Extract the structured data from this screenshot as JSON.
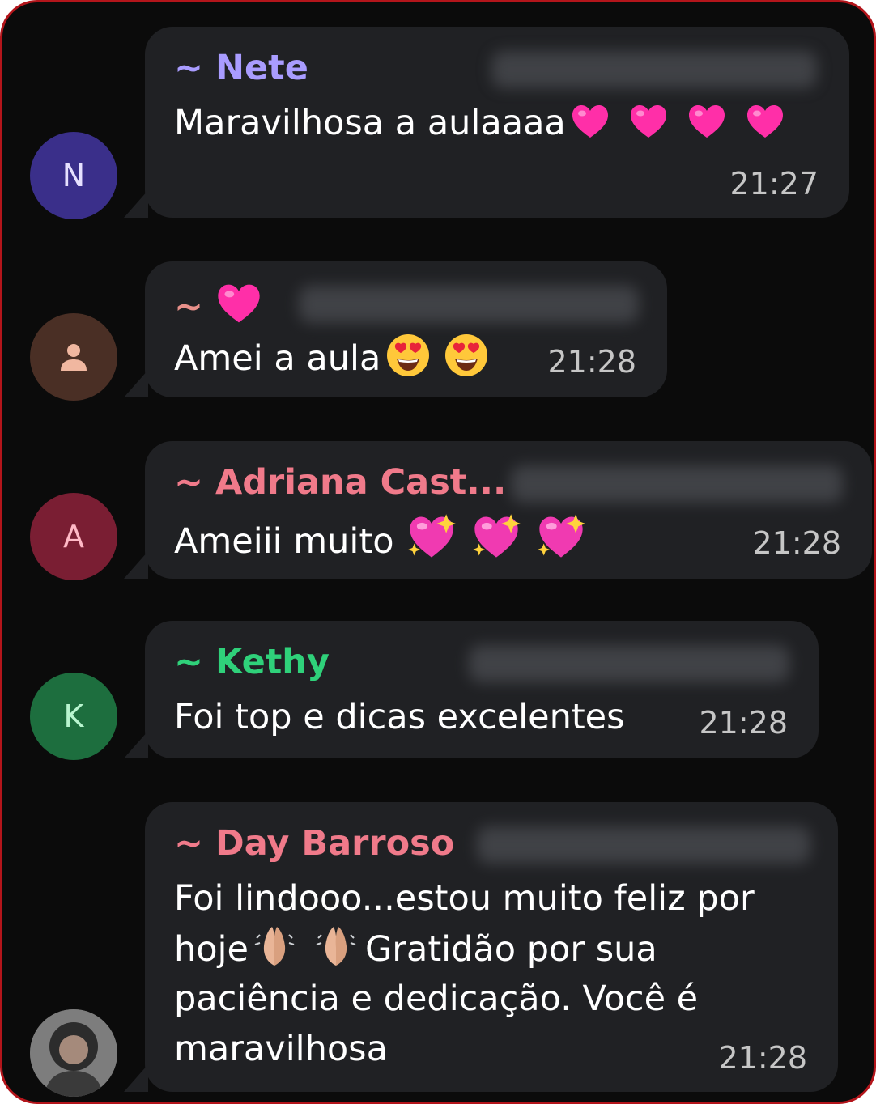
{
  "messages": [
    {
      "sender": "~ Nete",
      "sender_color": "#a99cff",
      "avatar_letter": "N",
      "avatar_bg": "#3a2f8a",
      "avatar_fg": "#e6e1ff",
      "text": "Maravilhosa a aulaaaa",
      "emoji": "pink-heart x4",
      "time": "21:27"
    },
    {
      "sender": "~",
      "sender_color": "#e8908a",
      "avatar_icon": "person-icon",
      "avatar_bg": "#4a2f25",
      "text": "Amei a aula",
      "emoji": "heart-eyes-face x2",
      "time": "21:28"
    },
    {
      "sender": "~ Adriana Cast...",
      "sender_color": "#f07a8a",
      "avatar_letter": "A",
      "avatar_bg": "#7a1e33",
      "avatar_fg": "#ffb9c6",
      "text": "Ameiii muito",
      "emoji": "sparkling-heart x3",
      "time": "21:28"
    },
    {
      "sender": "~ Kethy",
      "sender_color": "#2fd17a",
      "avatar_letter": "K",
      "avatar_bg": "#1d6e3e",
      "avatar_fg": "#b8f5cf",
      "text": "Foi top e dicas excelentes",
      "time": "21:28"
    },
    {
      "sender": "~ Day Barroso",
      "sender_color": "#f07a8a",
      "avatar_icon": "profile-photo",
      "text_line1": "Foi lindooo...estou muito feliz por",
      "text_line2a": "hoje",
      "text_line2b": "Gratidão por sua",
      "text_line3": "paciência e dedicação. Você é",
      "text_line4": "maravilhosa",
      "emoji": "folded-hands x2",
      "time": "21:28"
    }
  ]
}
